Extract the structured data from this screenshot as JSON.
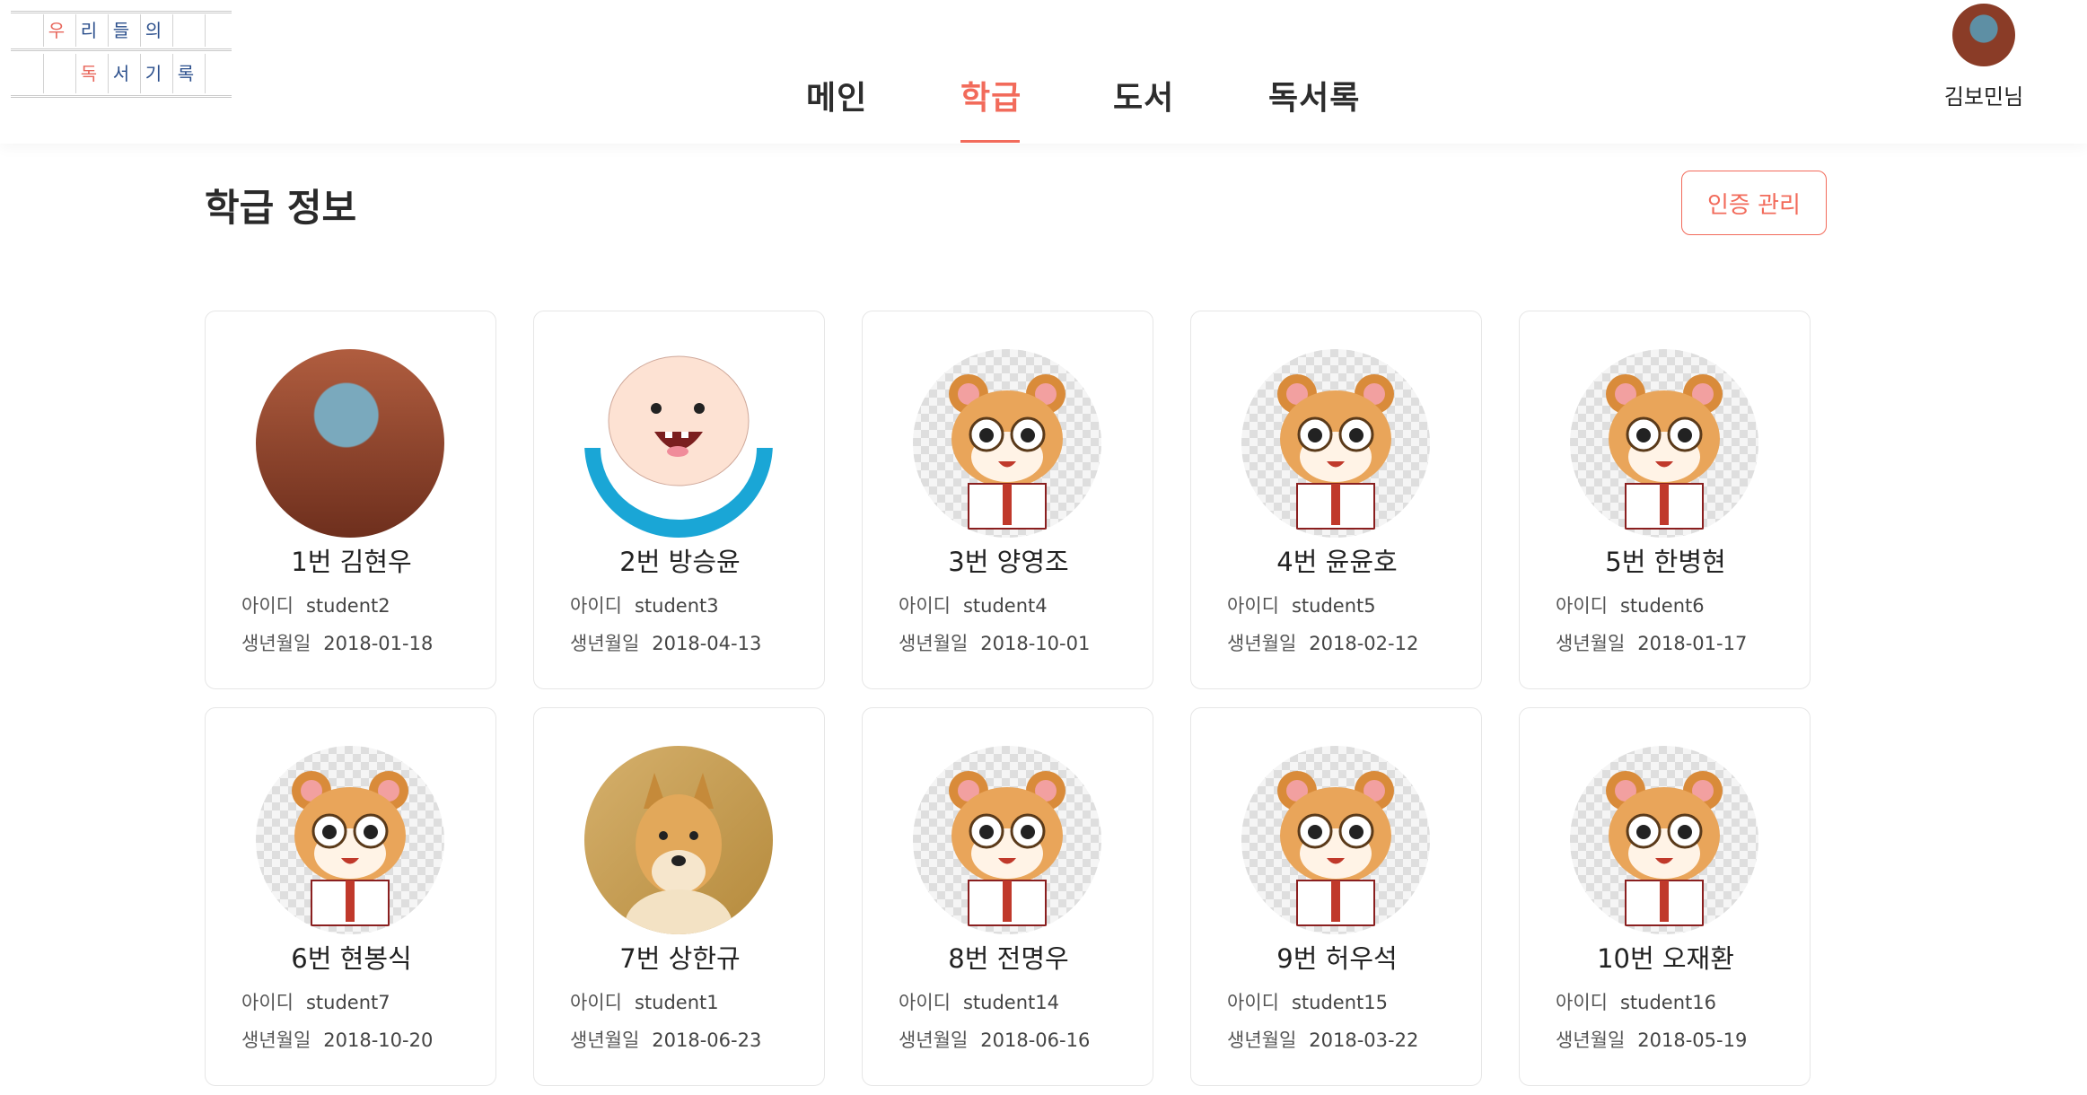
{
  "logo": {
    "row1": [
      "우",
      "리",
      "들",
      "의"
    ],
    "row2": [
      "독",
      "서",
      "기",
      "록"
    ]
  },
  "nav": {
    "items": [
      {
        "label": "메인"
      },
      {
        "label": "학급"
      },
      {
        "label": "도서"
      },
      {
        "label": "독서록"
      }
    ],
    "active": "학급"
  },
  "user": {
    "name": "김보민님",
    "avatar_icon": "user-avatar-icon"
  },
  "page": {
    "title": "학급 정보",
    "auth_button": "인증 관리"
  },
  "colors": {
    "accent": "#f26b5b",
    "text": "#222222",
    "card_border": "#e6e6e6"
  },
  "labels": {
    "id": "아이디",
    "birthdate": "생년월일"
  },
  "students": [
    {
      "name": "1번 김현우",
      "id": "student2",
      "birthdate": "2018-01-18",
      "avatar": "luffy-avatar-icon"
    },
    {
      "name": "2번 방승윤",
      "id": "student3",
      "birthdate": "2018-04-13",
      "avatar": "finn-avatar-icon"
    },
    {
      "name": "3번 양영조",
      "id": "student4",
      "birthdate": "2018-10-01",
      "avatar": "hamster-avatar-icon"
    },
    {
      "name": "4번 윤윤호",
      "id": "student5",
      "birthdate": "2018-02-12",
      "avatar": "hamster-avatar-icon"
    },
    {
      "name": "5번 한병현",
      "id": "student6",
      "birthdate": "2018-01-17",
      "avatar": "hamster-avatar-icon"
    },
    {
      "name": "6번 현봉식",
      "id": "student7",
      "birthdate": "2018-10-20",
      "avatar": "hamster-avatar-icon"
    },
    {
      "name": "7번 상한규",
      "id": "student1",
      "birthdate": "2018-06-23",
      "avatar": "doge-avatar-icon"
    },
    {
      "name": "8번 전명우",
      "id": "student14",
      "birthdate": "2018-06-16",
      "avatar": "hamster-avatar-icon"
    },
    {
      "name": "9번 허우석",
      "id": "student15",
      "birthdate": "2018-03-22",
      "avatar": "hamster-avatar-icon"
    },
    {
      "name": "10번 오재환",
      "id": "student16",
      "birthdate": "2018-05-19",
      "avatar": "hamster-avatar-icon"
    }
  ]
}
